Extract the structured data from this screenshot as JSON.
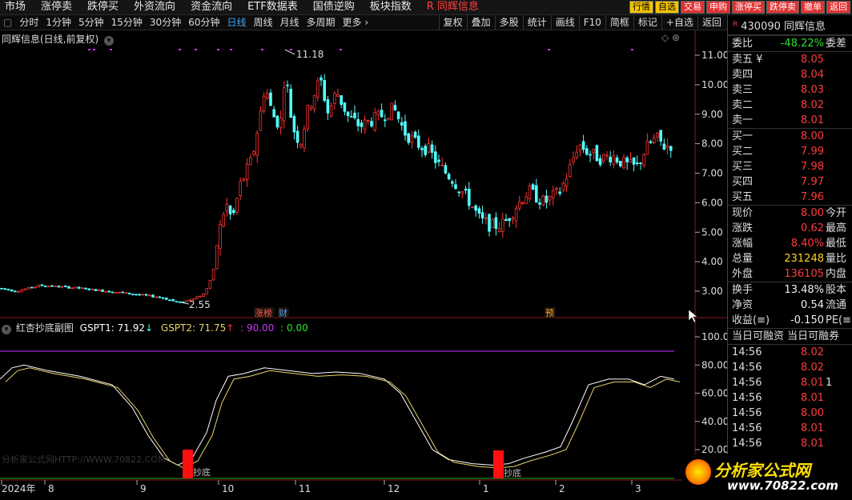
{
  "topmenu": [
    {
      "label": "市场",
      "hl": false
    },
    {
      "label": "涨停卖",
      "hl": false
    },
    {
      "label": "跌停买",
      "hl": false
    },
    {
      "label": "外资流向",
      "hl": false
    },
    {
      "label": "资金流向",
      "hl": false
    },
    {
      "label": "ETF数据表",
      "hl": false
    },
    {
      "label": "国债逆购",
      "hl": false
    },
    {
      "label": "板块指数",
      "hl": false
    },
    {
      "label": "R 同辉信息",
      "hl": true
    }
  ],
  "topright": [
    {
      "label": "行情",
      "style": "y"
    },
    {
      "label": "自选",
      "style": "y"
    },
    {
      "label": "交易",
      "style": "r"
    },
    {
      "label": "申购",
      "style": "r"
    },
    {
      "label": "涨停买",
      "style": "r"
    },
    {
      "label": "跌停卖",
      "style": "r"
    },
    {
      "label": "撤单",
      "style": "r"
    },
    {
      "label": "返回",
      "style": "r"
    }
  ],
  "periods": [
    "分时",
    "1分钟",
    "5分钟",
    "15分钟",
    "30分钟",
    "60分钟",
    "日线",
    "周线",
    "月线",
    "多周期",
    "更多 ›"
  ],
  "period_active": "日线",
  "tools": [
    "复权",
    "叠加",
    "多股",
    "统计",
    "画线",
    "F10",
    "简框",
    "标记",
    "+自选",
    "返回"
  ],
  "chart_title": "同辉信息(日线,前复权)",
  "high_label": "11.18",
  "low_label": "2.55",
  "event_tags": [
    {
      "label": "涨榜",
      "color": "#ff5a5a"
    },
    {
      "label": "财",
      "color": "#4fa3ff"
    },
    {
      "label": "预",
      "color": "#ffb030"
    }
  ],
  "indicator": {
    "name": "红杏抄底副图",
    "g1_label": "GSPT1: 71.92",
    "g1_arrow": "↓",
    "g2_label": "GSPT2: 71.75",
    "g2_arrow": "↑",
    "line90": ": 90.00",
    "line0": ": 0.00",
    "marker_text": "抄底",
    "watermark": "分析家公式网HTTP://WWW.70822.COM"
  },
  "price_ticks": [
    "11.00",
    "10.00",
    "9.00",
    "8.00",
    "7.00",
    "6.00",
    "5.00",
    "4.00",
    "3.00"
  ],
  "ind_ticks": [
    "100.0",
    "80.00",
    "60.00",
    "40.00",
    "20.00"
  ],
  "date_ticks": [
    "2024年",
    "8",
    "9",
    "10",
    "11",
    "12",
    "1",
    "2",
    "3"
  ],
  "quote": {
    "code": "430090 同辉信息",
    "weibi_label": "委比",
    "weibi": "-48.22%",
    "weicha": "委差",
    "asks": [
      {
        "l": "卖五 ¥",
        "v": "8.05"
      },
      {
        "l": "卖四",
        "v": "8.04"
      },
      {
        "l": "卖三",
        "v": "8.03"
      },
      {
        "l": "卖二",
        "v": "8.02"
      },
      {
        "l": "卖一",
        "v": "8.01"
      }
    ],
    "bids": [
      {
        "l": "买一",
        "v": "8.00"
      },
      {
        "l": "买二",
        "v": "7.99"
      },
      {
        "l": "买三",
        "v": "7.98"
      },
      {
        "l": "买四",
        "v": "7.97"
      },
      {
        "l": "买五",
        "v": "7.96"
      }
    ],
    "stats": [
      {
        "l": "现价",
        "v": "8.00",
        "c": "red",
        "e": "今开"
      },
      {
        "l": "涨跌",
        "v": "0.62",
        "c": "red",
        "e": "最高"
      },
      {
        "l": "涨幅",
        "v": "8.40%",
        "c": "red",
        "e": "最低"
      },
      {
        "l": "总量",
        "v": "231248",
        "c": "yel",
        "e": "量比"
      },
      {
        "l": "外盘",
        "v": "136105",
        "c": "red",
        "e": "内盘"
      }
    ],
    "stats2": [
      {
        "l": "换手",
        "v": "13.48%",
        "c": "wht",
        "e": "股本"
      },
      {
        "l": "净资",
        "v": "0.54",
        "c": "wht",
        "e": "流通"
      },
      {
        "l": "收益(≡)",
        "v": "-0.150",
        "c": "wht",
        "e": "PE(≡)"
      }
    ],
    "trade_header": "当日可融资  当日可融券",
    "trades": [
      {
        "t": "14:56",
        "p": "8.02",
        "v": ""
      },
      {
        "t": "14:56",
        "p": "8.02",
        "v": ""
      },
      {
        "t": "14:56",
        "p": "8.01",
        "v": "1"
      },
      {
        "t": "14:56",
        "p": "8.01",
        "v": ""
      },
      {
        "t": "14:56",
        "p": "8.00",
        "v": ""
      },
      {
        "t": "14:56",
        "p": "8.01",
        "v": ""
      },
      {
        "t": "14:56",
        "p": "8.01",
        "v": ""
      }
    ]
  },
  "watermark_logo": "分析家公式网",
  "watermark_url": "www.70822.com",
  "colors": {
    "up": "#ff3232",
    "down": "#54ffff",
    "purple": "#cc33ff",
    "yellow": "#e8d26a",
    "white": "#ffffff",
    "green": "#1faa1f"
  }
}
